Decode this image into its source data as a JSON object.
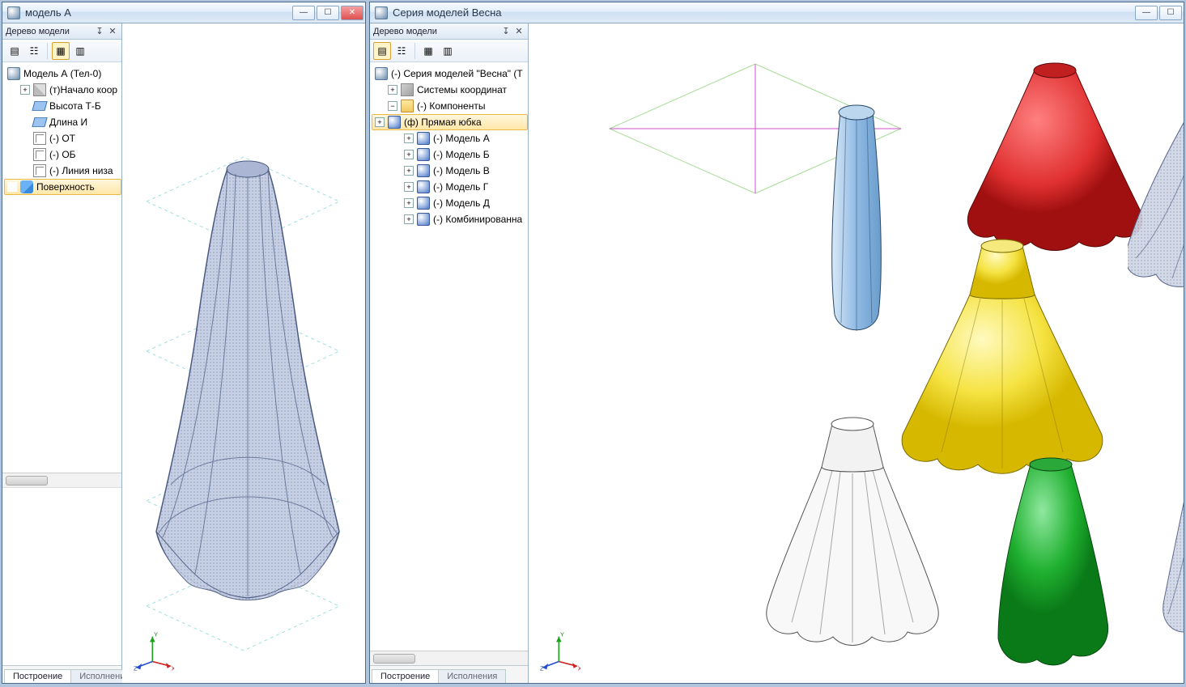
{
  "left_window": {
    "title": "модель А",
    "panel_title": "Дерево модели",
    "tree": {
      "root": "Модель А (Тел-0)",
      "items": [
        "(т)Начало коор",
        "Высота Т-Б",
        "Длина И",
        "(-) ОТ",
        "(-) ОБ",
        "(-) Линия низа",
        "Поверхность"
      ]
    },
    "tabs": {
      "active": "Построение",
      "inactive": "Исполнения"
    }
  },
  "right_window": {
    "title": "Серия моделей Весна",
    "panel_title": "Дерево модели",
    "tree": {
      "root": "(-) Серия моделей \"Весна\" (Т",
      "items": [
        "Системы координат",
        "(-) Компоненты"
      ],
      "components": [
        "(ф) Прямая юбка",
        "(-) Модель А",
        "(-) Модель Б",
        "(-) Модель В",
        "(-) Модель Г",
        "(-) Модель Д",
        "(-) Комбинированна"
      ]
    },
    "tabs": {
      "active": "Построение",
      "inactive": "Исполнения"
    }
  },
  "triad": {
    "x": "X",
    "y": "Y",
    "z": "Z"
  },
  "models": {
    "colors": {
      "wire": "#7a8db8",
      "blue": "#9bc1e8",
      "red": "#e03030",
      "yellow": "#f5e342",
      "green": "#20b030",
      "white": "#f0f0f0"
    }
  }
}
